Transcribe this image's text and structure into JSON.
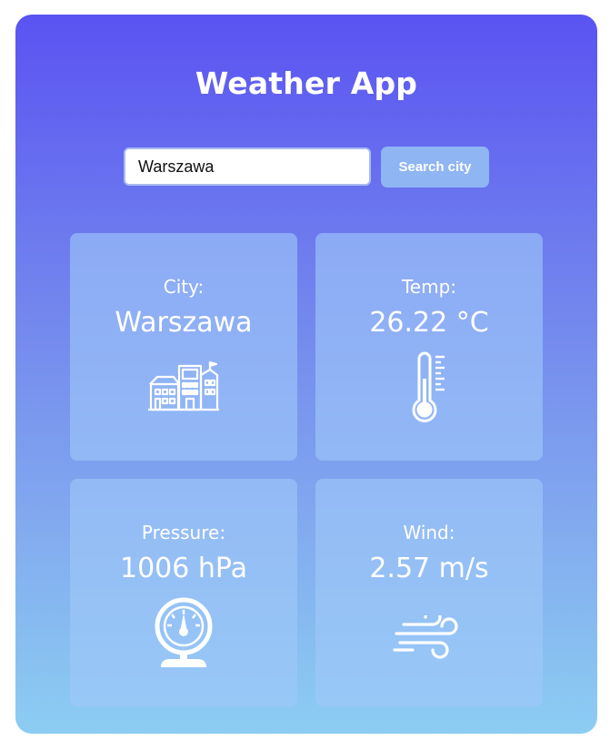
{
  "app": {
    "title": "Weather App"
  },
  "search": {
    "value": "Warszawa",
    "button_label": "Search city"
  },
  "cards": [
    {
      "label": "City:",
      "value": "Warszawa",
      "icon": "city-buildings-icon"
    },
    {
      "label": "Temp:",
      "value": "26.22 °C",
      "icon": "thermometer-icon"
    },
    {
      "label": "Pressure:",
      "value": "1006 hPa",
      "icon": "pressure-gauge-icon"
    },
    {
      "label": "Wind:",
      "value": "2.57 m/s",
      "icon": "wind-icon"
    }
  ],
  "colors": {
    "gradient_top": "#5a53f2",
    "gradient_bottom": "#8ccdf2",
    "card_background": "#a0c8f8",
    "button_background": "#8fb5f3",
    "text": "#ffffff"
  }
}
